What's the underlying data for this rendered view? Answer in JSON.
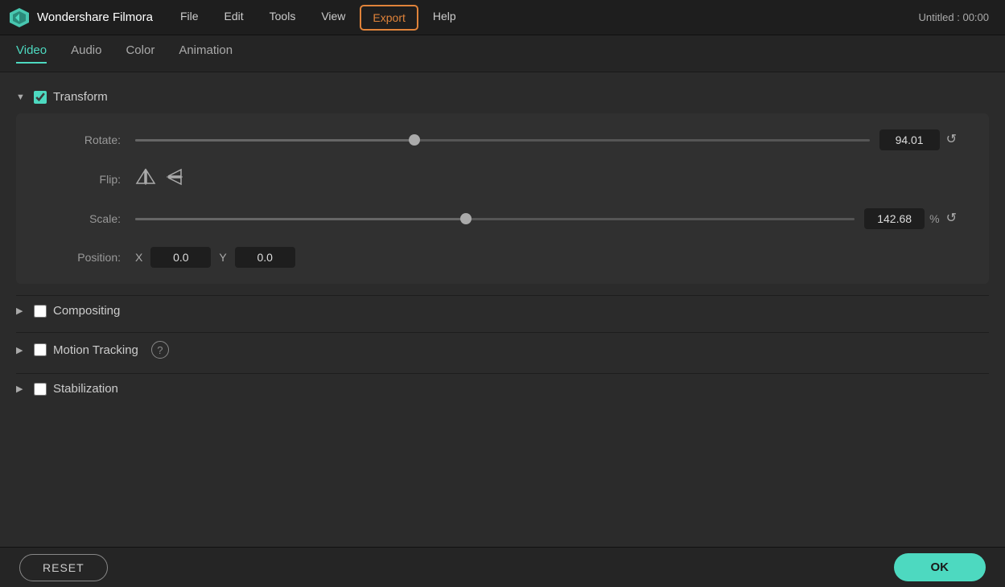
{
  "menuBar": {
    "logoText": "Wondershare Filmora",
    "menuItems": [
      "File",
      "Edit",
      "Tools",
      "View",
      "Export",
      "Help"
    ],
    "titleRight": "Untitled : 00:00"
  },
  "tabs": {
    "items": [
      "Video",
      "Audio",
      "Color",
      "Animation"
    ],
    "active": "Video"
  },
  "transform": {
    "sectionTitle": "Transform",
    "rotateLabel": "Rotate:",
    "rotateValue": "94.01",
    "rotateThumbPct": 38,
    "flipLabel": "Flip:",
    "scaleLabel": "Scale:",
    "scaleValue": "142.68",
    "scalePercent": "%",
    "scaleThumbPct": 46,
    "positionLabel": "Position:",
    "posX_label": "X",
    "posX_value": "0.0",
    "posY_label": "Y",
    "posY_value": "0.0"
  },
  "compositing": {
    "sectionTitle": "Compositing"
  },
  "motionTracking": {
    "sectionTitle": "Motion Tracking",
    "helpTooltip": "?"
  },
  "stabilization": {
    "sectionTitle": "Stabilization"
  },
  "bottomBar": {
    "resetLabel": "RESET",
    "okLabel": "OK"
  }
}
